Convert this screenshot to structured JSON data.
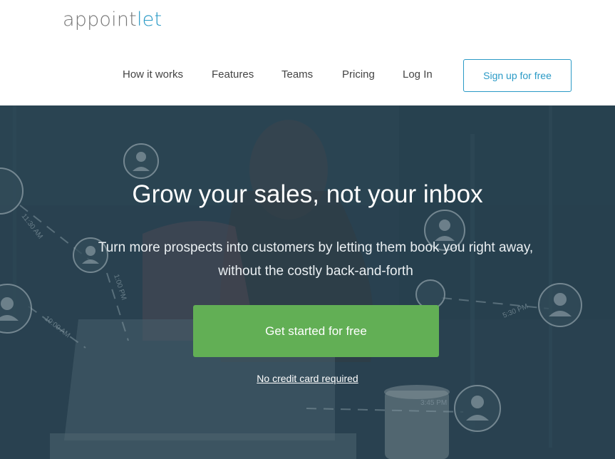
{
  "brand": {
    "name_part1": "appoint",
    "name_part2": "let"
  },
  "nav": {
    "items": [
      "How it works",
      "Features",
      "Teams",
      "Pricing",
      "Log In"
    ],
    "signup_label": "Sign up for free"
  },
  "hero": {
    "headline": "Grow your sales, not your inbox",
    "subhead": "Turn more prospects into customers by letting them book you right away, without the costly back-and-forth",
    "cta_label": "Get started for free",
    "note": "No credit card required",
    "time_labels": [
      "11:30 AM",
      "1:00 PM",
      "10:00 AM",
      "5:30 PM",
      "3:45 PM"
    ]
  },
  "colors": {
    "accent": "#2a9ac6",
    "cta": "#62af55",
    "hero_overlay": "#2c4454"
  }
}
